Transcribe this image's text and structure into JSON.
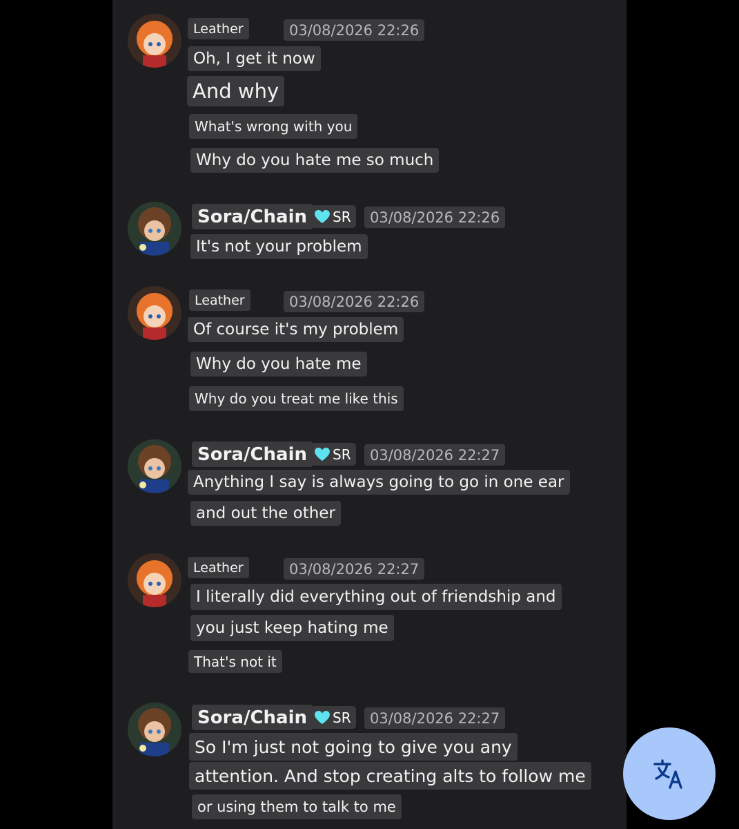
{
  "messages": [
    {
      "author": "Leather",
      "timestamp": "03/08/2026 22:26",
      "lines": [
        "Oh, I get it now",
        "And why",
        "What's wrong with you",
        "Why do you hate me so much"
      ]
    },
    {
      "author": "Sora/Chain",
      "badge": "SR",
      "timestamp": "03/08/2026 22:26",
      "lines": [
        "It's not your problem"
      ]
    },
    {
      "author": "Leather",
      "timestamp": "03/08/2026 22:26",
      "lines": [
        "Of course it's my problem",
        "Why do you hate me",
        "Why do you treat me like this"
      ]
    },
    {
      "author": "Sora/Chain",
      "badge": "SR",
      "timestamp": "03/08/2026 22:27",
      "lines": [
        "Anything I say is always going to go in one ear",
        "and out the other"
      ]
    },
    {
      "author": "Leather",
      "timestamp": "03/08/2026 22:27",
      "lines": [
        "I literally did everything out of friendship and",
        "you just keep hating me",
        "That's not it"
      ]
    },
    {
      "author": "Sora/Chain",
      "badge": "SR",
      "timestamp": "03/08/2026 22:27",
      "lines": [
        "So I'm just not going to give you any",
        "attention. And stop creating alts to follow me",
        "or using them to talk to me"
      ]
    }
  ],
  "icons": {
    "badge": "heart-icon",
    "fab": "translate-icon"
  },
  "colors": {
    "background": "#000000",
    "panel": "#1e1e20",
    "chip": "#3a3a3c",
    "fab": "#a8c7fa",
    "heart": "#5ee3f0"
  }
}
